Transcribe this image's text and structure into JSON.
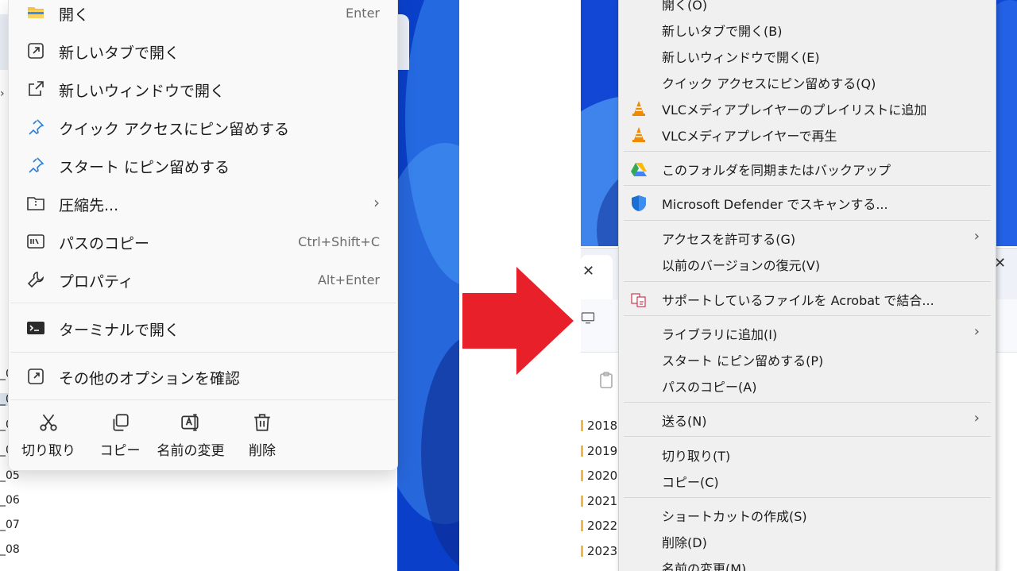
{
  "win11_menu": {
    "items": [
      {
        "icon": "folder-icon",
        "label": "開く",
        "accel": "Enter"
      },
      {
        "icon": "open-new-tab-icon",
        "label": "新しいタブで開く",
        "accel": ""
      },
      {
        "icon": "open-new-window-icon",
        "label": "新しいウィンドウで開く",
        "accel": ""
      },
      {
        "icon": "pin-icon",
        "label": "クイック アクセスにピン留めする",
        "accel": ""
      },
      {
        "icon": "pin-icon",
        "label": "スタート にピン留めする",
        "accel": ""
      },
      {
        "icon": "compress-folder-icon",
        "label": "圧縮先...",
        "accel": "›"
      },
      {
        "icon": "copy-path-icon",
        "label": "パスのコピー",
        "accel": "Ctrl+Shift+C"
      },
      {
        "icon": "wrench-icon",
        "label": "プロパティ",
        "accel": "Alt+Enter"
      },
      {
        "icon": "terminal-icon",
        "label": "ターミナルで開く",
        "accel": ""
      },
      {
        "icon": "more-options-icon",
        "label": "その他のオプションを確認",
        "accel": ""
      }
    ],
    "actions": [
      {
        "icon": "scissors-icon",
        "label": "切り取り"
      },
      {
        "icon": "copy-icon",
        "label": "コピー"
      },
      {
        "icon": "rename-icon",
        "label": "名前の変更"
      },
      {
        "icon": "trash-icon",
        "label": "削除"
      }
    ]
  },
  "left_background_files": [
    "_0",
    "_0",
    "_0",
    "_0",
    "_05",
    "_06",
    "_07",
    "_08"
  ],
  "classic_menu": {
    "items": [
      {
        "icon": "",
        "label": "開く(O)",
        "submenu": false
      },
      {
        "icon": "",
        "label": "新しいタブで開く(B)",
        "submenu": false
      },
      {
        "icon": "",
        "label": "新しいウィンドウで開く(E)",
        "submenu": false
      },
      {
        "icon": "",
        "label": "クイック アクセスにピン留めする(Q)",
        "submenu": false
      },
      {
        "icon": "vlc-cone-icon",
        "label": "VLCメディアプレイヤーのプレイリストに追加",
        "submenu": false
      },
      {
        "icon": "vlc-cone-icon",
        "label": "VLCメディアプレイヤーで再生",
        "submenu": false
      },
      {
        "icon": "google-drive-icon",
        "label": "このフォルダを同期またはバックアップ",
        "submenu": false
      },
      {
        "icon": "defender-shield-icon",
        "label": "Microsoft Defender でスキャンする...",
        "submenu": false
      },
      {
        "icon": "",
        "label": "アクセスを許可する(G)",
        "submenu": true
      },
      {
        "icon": "",
        "label": "以前のバージョンの復元(V)",
        "submenu": false
      },
      {
        "icon": "acrobat-combine-icon",
        "label": "サポートしているファイルを Acrobat で結合...",
        "submenu": false
      },
      {
        "icon": "",
        "label": "ライブラリに追加(I)",
        "submenu": true
      },
      {
        "icon": "",
        "label": "スタート にピン留めする(P)",
        "submenu": false
      },
      {
        "icon": "",
        "label": "パスのコピー(A)",
        "submenu": false
      },
      {
        "icon": "",
        "label": "送る(N)",
        "submenu": true
      },
      {
        "icon": "",
        "label": "切り取り(T)",
        "submenu": false
      },
      {
        "icon": "",
        "label": "コピー(C)",
        "submenu": false
      },
      {
        "icon": "",
        "label": "ショートカットの作成(S)",
        "submenu": false
      },
      {
        "icon": "",
        "label": "削除(D)",
        "submenu": false
      },
      {
        "icon": "",
        "label": "名前の変更(M)",
        "submenu": false
      }
    ],
    "submenu_glyph": "›"
  },
  "right_background": {
    "years": [
      "2018",
      "2019",
      "2020",
      "2021",
      "2022",
      "2023"
    ],
    "close_glyph": "✕"
  },
  "colors": {
    "arrow": "#e8202a",
    "wallpaper": "#0a3fc9",
    "vlc_orange": "#f08a00",
    "defender_blue": "#1a6fd6"
  }
}
